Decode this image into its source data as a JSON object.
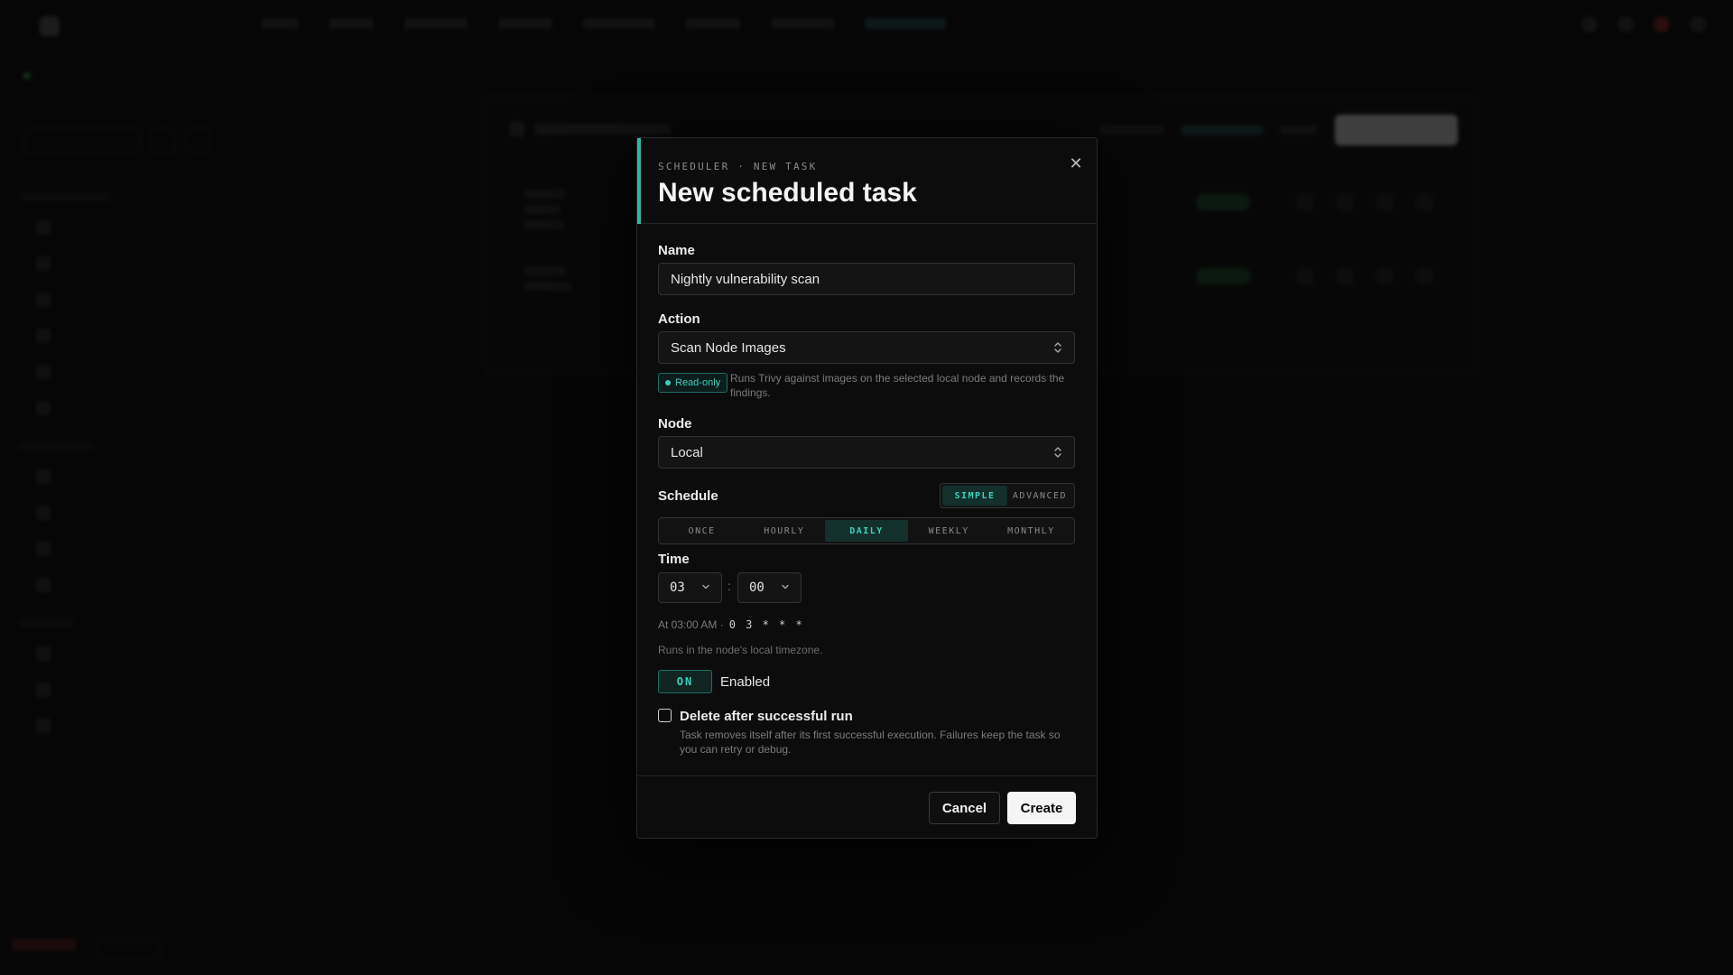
{
  "modal": {
    "eyebrow": "SCHEDULER · NEW TASK",
    "title": "New scheduled task",
    "close_glyph": "✕",
    "name": {
      "label": "Name",
      "value": "Nightly vulnerability scan"
    },
    "action": {
      "label": "Action",
      "value": "Scan Node Images",
      "badge": "Read-only",
      "help": "Runs Trivy against images on the selected local node and records the findings."
    },
    "node": {
      "label": "Node",
      "value": "Local"
    },
    "schedule": {
      "label": "Schedule",
      "modes": [
        "SIMPLE",
        "ADVANCED"
      ],
      "active_mode": "SIMPLE",
      "frequencies": [
        "ONCE",
        "HOURLY",
        "DAILY",
        "WEEKLY",
        "MONTHLY"
      ],
      "active_frequency": "DAILY"
    },
    "time": {
      "label": "Time",
      "hour": "03",
      "minute": "00",
      "separator": ":",
      "summary": "At 03:00 AM ·",
      "cron": "0 3 * * *",
      "timezone_note": "Runs in the node's local timezone."
    },
    "enabled": {
      "toggle_text": "ON",
      "label": "Enabled",
      "on": true
    },
    "delete_after": {
      "label": "Delete after successful run",
      "checked": false,
      "help": "Task removes itself after its first successful execution. Failures keep the task so you can retry or debug."
    },
    "buttons": {
      "cancel": "Cancel",
      "create": "Create"
    }
  },
  "colors": {
    "accent": "#2fb7a6",
    "accent_text": "#3dd0bd",
    "background": "#060606",
    "modal_bg": "#0c0c0c",
    "primary_button": "#f5f5f5"
  },
  "icons": {
    "close": "close-icon",
    "select_caret": "chevron-up-down-icon",
    "time_caret": "chevron-down-icon",
    "badge_dot": "status-dot-icon"
  }
}
